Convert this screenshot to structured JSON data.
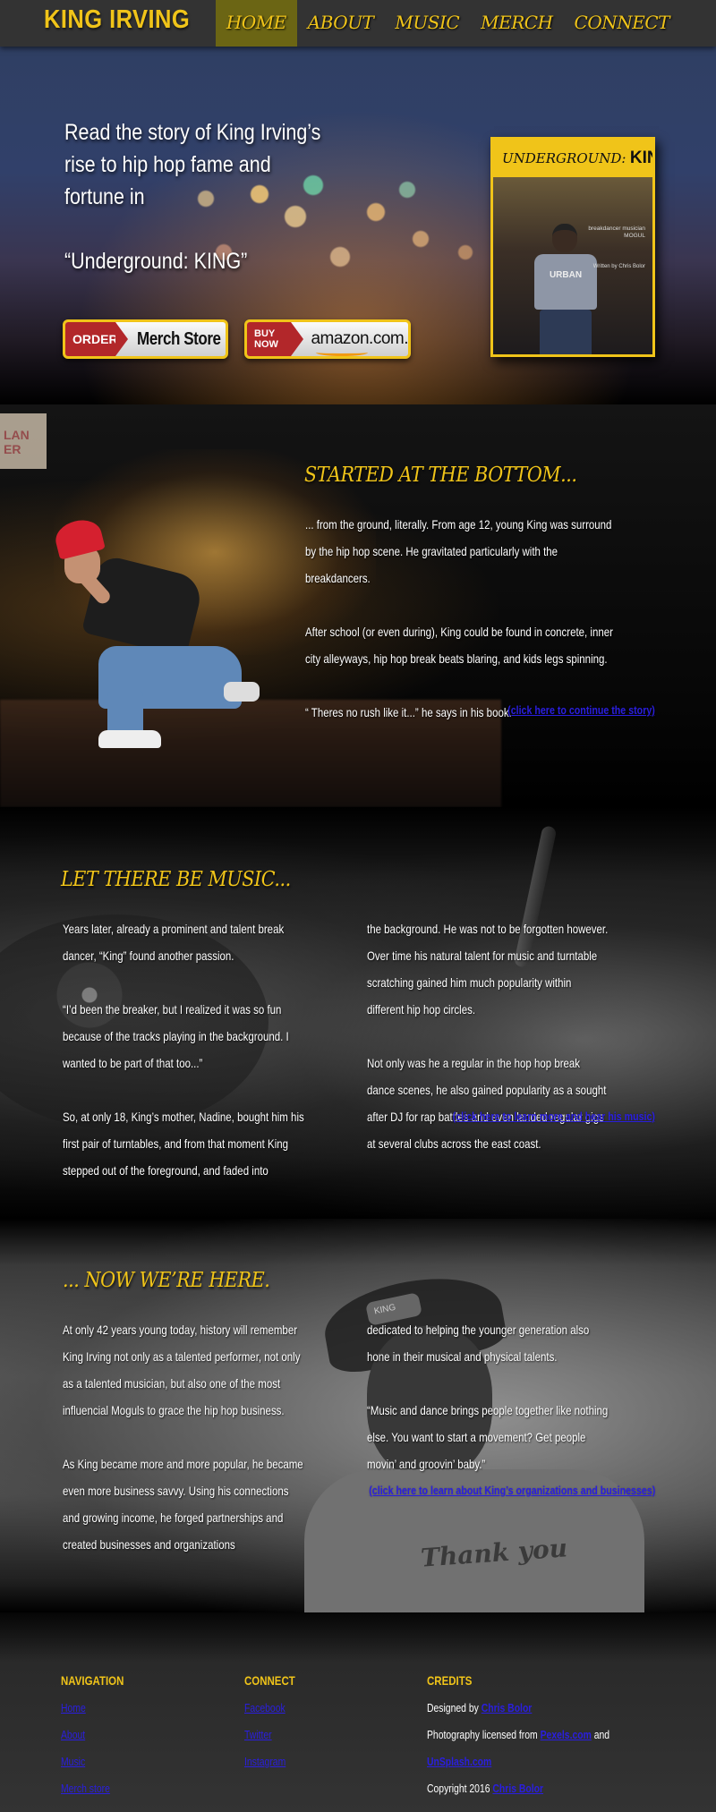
{
  "nav": {
    "brand": "KING IRVING",
    "items": [
      {
        "label": "HOME",
        "active": true
      },
      {
        "label": "ABOUT"
      },
      {
        "label": "MUSIC"
      },
      {
        "label": "MERCH"
      },
      {
        "label": "CONNECT"
      }
    ]
  },
  "hero": {
    "line1": "Read the story of King Irving’s rise to hip hop fame and fortune in",
    "line2": "“Underground: KING”",
    "merch_button": {
      "tag": "ORDER",
      "label": "Merch Store"
    },
    "amazon_button": {
      "tag": "BUY NOW",
      "label": "amazon.com."
    },
    "book": {
      "title_italic": "UNDERGROUND:",
      "title_bold": "KING",
      "shirt": "URBAN",
      "blurb": "breakdancer musician MOGUL",
      "author": "Written by Chris Bolor"
    }
  },
  "section1": {
    "title": "STARTED AT THE BOTTOM...",
    "paragraphs": [
      "... from the ground, literally. From age 12, young King was surround by the hip hop scene. He gravitated particularly with the breakdancers.",
      "After school (or even during), King could be found in concrete, inner city alleyways, hip hop break beats blaring, and kids legs spinning.",
      "“ Theres no rush like it...” he says in his book."
    ],
    "link": "(click here to continue the story)",
    "sign": "LAN ER"
  },
  "section2": {
    "title": "LET THERE BE MUSIC...",
    "col1": [
      "Years later, already a prominent and talent break dancer, “King” found another passion.",
      "“I’d been the breaker, but I realized it was so fun because of the tracks playing  in the background. I wanted to be part of that too...”",
      "So, at only 18,  King’s mother, Nadine, bought him his first pair of turntables, and from that moment King stepped out of the foreground, and faded into"
    ],
    "col2": [
      "the background. He was not to be forgotten however. Over time his natural talent for music and turntable scratching gained him much popularity within different hip hop circles.",
      "Not only was he a regular in the hop hop break dance scenes, he also gained popularity as a sought after DJ for rap battles and even landed regular gigs at several clubs across the east coast."
    ],
    "link": "(click here to learn more and hear his music)"
  },
  "section3": {
    "title": "... NOW WE’RE HERE.",
    "col1": [
      "At only 42 years young today, history will remember King Irving not only as a talented performer, not only as a talented musician, but also one of the most influencial Moguls to grace the hip hop business.",
      "As King became more and more popular, he became even more business savvy. Using his connections and growing income, he forged partnerships and created businesses and organizations"
    ],
    "col2": [
      "dedicated to helping the younger generation also hone in their musical and physical talents.",
      "“Music and dance brings people together like nothing else. You want to start a movement? Get people movin’ and groovin’ baby.”"
    ],
    "link": "(click here to learn about King’s organizations and businesses)",
    "cap_text": "KING",
    "tee_text": "Thank you"
  },
  "footer": {
    "navigation": {
      "heading": "NAVIGATION",
      "links": [
        "Home",
        "About",
        "Music",
        "Merch store"
      ]
    },
    "connect": {
      "heading": "CONNECT",
      "links": [
        "Facebook",
        "Twitter",
        "Instagram"
      ]
    },
    "credits": {
      "heading": "CREDITS",
      "designed_prefix": "Designed by ",
      "designer": "Chris Bolor",
      "photo_prefix": "Photography licensed from ",
      "photo_source1": "Pexels.com",
      "photo_and": " and",
      "photo_source2": "UnSplash.com",
      "copyright_prefix": "Copyright 2016 ",
      "copyright_name": "Chris Bolor"
    }
  },
  "colors": {
    "accent": "#f0c419",
    "nav_bg": "#333333",
    "nav_active": "#6b6514",
    "link": "#2a1ee0"
  }
}
